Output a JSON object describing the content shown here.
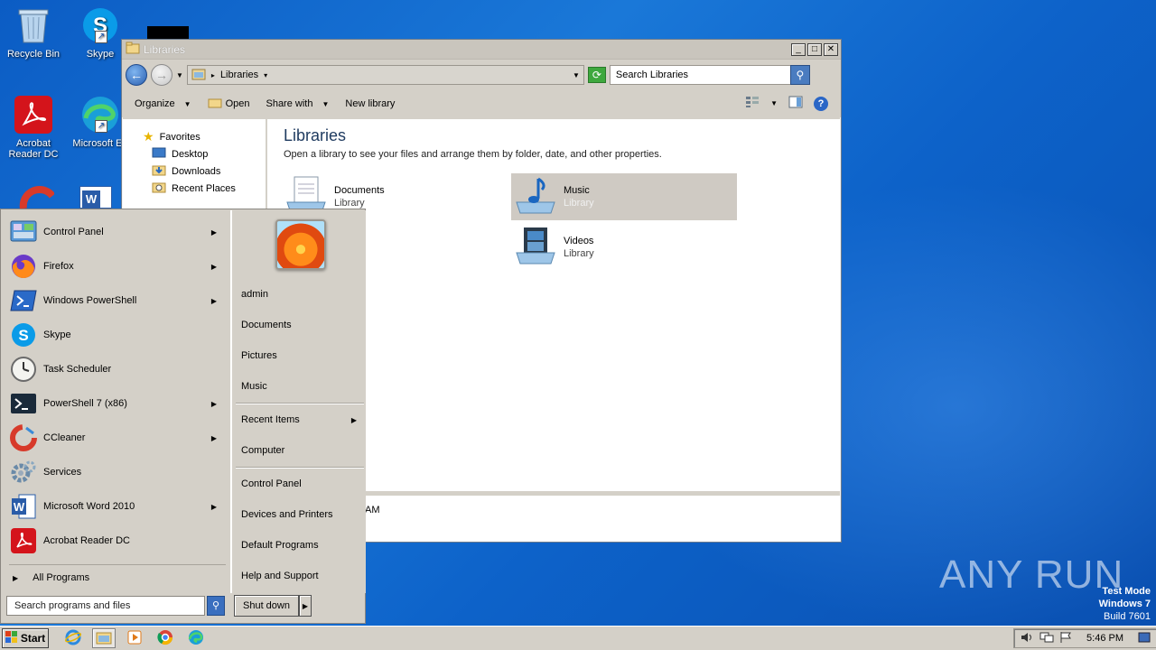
{
  "desktop": {
    "icons": [
      {
        "label": "Recycle Bin"
      },
      {
        "label": "Skype"
      },
      {
        "label": "Acrobat Reader DC"
      },
      {
        "label": "Microsoft Ed"
      }
    ]
  },
  "explorer": {
    "title": "Libraries",
    "address": "Libraries",
    "search_placeholder": "Search Libraries",
    "toolbar": {
      "organize": "Organize",
      "open": "Open",
      "share_with": "Share with",
      "new_library": "New library"
    },
    "nav": {
      "favorites": "Favorites",
      "items": [
        "Desktop",
        "Downloads",
        "Recent Places"
      ]
    },
    "content": {
      "heading": "Libraries",
      "description": "Open a library to see your files and arrange them by folder, date, and other properties.",
      "libraries": [
        {
          "name": "Documents",
          "type": "Library"
        },
        {
          "name": "Music",
          "type": "Library"
        },
        {
          "name": "Videos",
          "type": "Library"
        }
      ]
    },
    "details_fragment": "AM"
  },
  "start_menu": {
    "programs": [
      {
        "label": "Control Panel",
        "has_arrow": true
      },
      {
        "label": "Firefox",
        "has_arrow": true
      },
      {
        "label": "Windows PowerShell",
        "has_arrow": true
      },
      {
        "label": "Skype",
        "has_arrow": false
      },
      {
        "label": "Task Scheduler",
        "has_arrow": false
      },
      {
        "label": "PowerShell 7 (x86)",
        "has_arrow": true
      },
      {
        "label": "CCleaner",
        "has_arrow": true
      },
      {
        "label": "Services",
        "has_arrow": false
      },
      {
        "label": "Microsoft Word 2010",
        "has_arrow": true
      },
      {
        "label": "Acrobat Reader DC",
        "has_arrow": false
      }
    ],
    "all_programs": "All Programs",
    "search_placeholder": "Search programs and files",
    "right": {
      "user": "admin",
      "documents": "Documents",
      "pictures": "Pictures",
      "music": "Music",
      "recent_items": "Recent Items",
      "computer": "Computer",
      "control_panel": "Control Panel",
      "devices_printers": "Devices and Printers",
      "default_programs": "Default Programs",
      "help_support": "Help and Support"
    },
    "shutdown": "Shut down"
  },
  "taskbar": {
    "start": "Start",
    "clock": "5:46 PM"
  },
  "watermark": {
    "line1": "Test Mode",
    "line2": "Windows 7",
    "line3": "Build 7601",
    "anyrun": "ANY RUN"
  }
}
